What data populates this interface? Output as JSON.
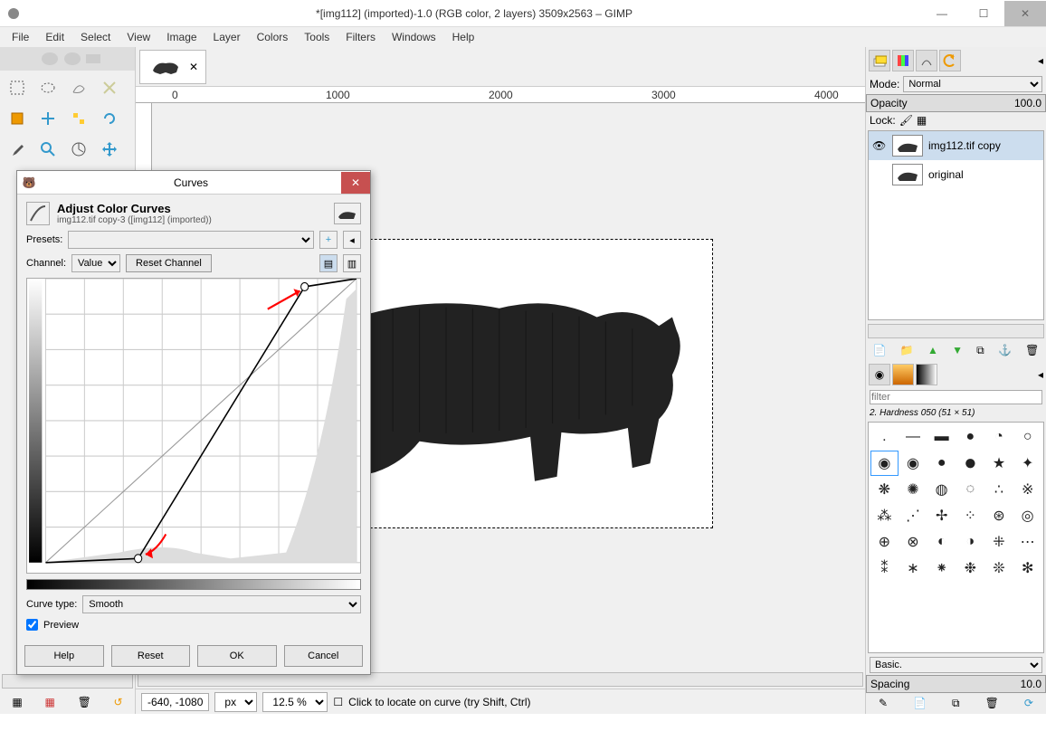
{
  "window": {
    "title": "*[img112] (imported)-1.0 (RGB color, 2 layers) 3509x2563 – GIMP"
  },
  "menu": [
    "File",
    "Edit",
    "Select",
    "View",
    "Image",
    "Layer",
    "Colors",
    "Tools",
    "Filters",
    "Windows",
    "Help"
  ],
  "tab": {
    "close": "✕"
  },
  "ruler": {
    "m0": "0",
    "m1": "1000",
    "m2": "2000",
    "m3": "3000",
    "m4": "4000"
  },
  "layers_panel": {
    "mode_label": "Mode:",
    "mode_value": "Normal",
    "opacity_label": "Opacity",
    "opacity_value": "100.0",
    "lock_label": "Lock:",
    "layers": [
      {
        "name": "img112.tif copy",
        "visible": true,
        "selected": true
      },
      {
        "name": "original",
        "visible": false,
        "selected": false
      }
    ]
  },
  "brush_panel": {
    "filter_placeholder": "filter",
    "current": "2. Hardness 050 (51 × 51)",
    "preset_label": "Basic.",
    "spacing_label": "Spacing",
    "spacing_value": "10.0"
  },
  "status": {
    "coords": "-640, -1080",
    "unit": "px",
    "zoom": "12.5 %",
    "hint": "Click to locate on curve (try Shift, Ctrl)"
  },
  "curves_dialog": {
    "title": "Curves",
    "heading": "Adjust Color Curves",
    "subheading": "img112.tif copy-3 ([img112] (imported))",
    "presets_label": "Presets:",
    "channel_label": "Channel:",
    "channel_value": "Value",
    "reset_channel": "Reset Channel",
    "curve_type_label": "Curve type:",
    "curve_type_value": "Smooth",
    "preview_label": "Preview",
    "help": "Help",
    "reset": "Reset",
    "ok": "OK",
    "cancel": "Cancel"
  }
}
